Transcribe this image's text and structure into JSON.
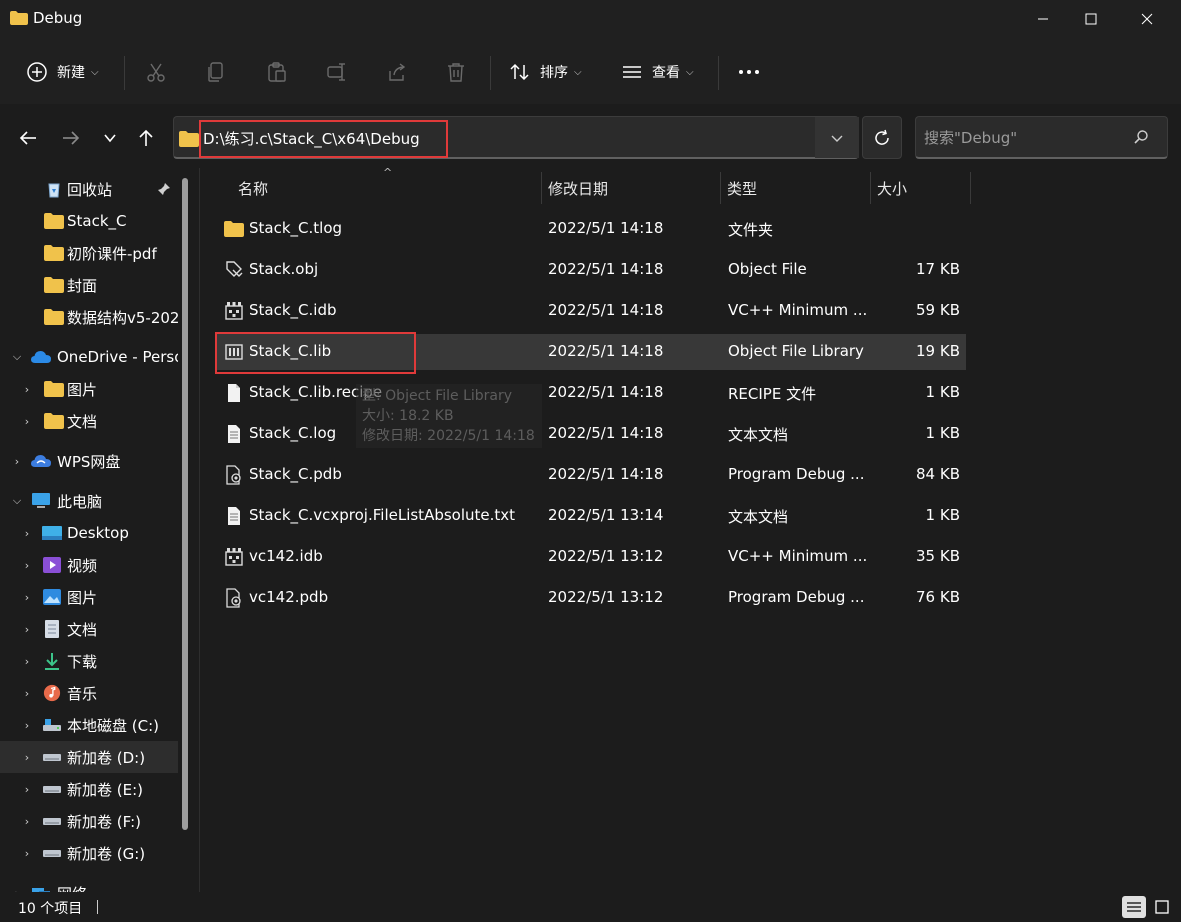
{
  "window": {
    "title": "Debug",
    "minimize_icon": "minimize-icon",
    "maximize_icon": "maximize-icon",
    "close_icon": "close-icon"
  },
  "toolbar": {
    "new_label": "新建",
    "sort_label": "排序",
    "view_label": "查看",
    "icons": [
      "cut-icon",
      "copy-icon",
      "paste-icon",
      "rename-icon",
      "share-icon",
      "delete-icon",
      "more-icon"
    ]
  },
  "address": {
    "path": "D:\\练习.c\\Stack_C\\x64\\Debug"
  },
  "search": {
    "placeholder": "搜索\"Debug\""
  },
  "sidebar": {
    "items": [
      {
        "label": "回收站",
        "icon": "recycle-bin-icon",
        "pinned": true
      },
      {
        "label": "Stack_C",
        "icon": "folder-icon"
      },
      {
        "label": "初阶课件-pdf",
        "icon": "folder-icon"
      },
      {
        "label": "封面",
        "icon": "folder-icon"
      },
      {
        "label": "数据结构v5-202",
        "icon": "folder-icon"
      },
      {
        "label": "OneDrive - Perso",
        "icon": "onedrive-icon"
      },
      {
        "label": "图片",
        "icon": "folder-icon"
      },
      {
        "label": "文档",
        "icon": "folder-icon"
      },
      {
        "label": "WPS网盘",
        "icon": "wps-cloud-icon"
      },
      {
        "label": "此电脑",
        "icon": "pc-icon"
      },
      {
        "label": "Desktop",
        "icon": "desktop-icon"
      },
      {
        "label": "视频",
        "icon": "videos-icon"
      },
      {
        "label": "图片",
        "icon": "pictures-icon"
      },
      {
        "label": "文档",
        "icon": "documents-icon"
      },
      {
        "label": "下载",
        "icon": "downloads-icon"
      },
      {
        "label": "音乐",
        "icon": "music-icon"
      },
      {
        "label": "本地磁盘 (C:)",
        "icon": "drive-c-icon"
      },
      {
        "label": "新加卷 (D:)",
        "icon": "drive-icon"
      },
      {
        "label": "新加卷 (E:)",
        "icon": "drive-icon"
      },
      {
        "label": "新加卷 (F:)",
        "icon": "drive-icon"
      },
      {
        "label": "新加卷 (G:)",
        "icon": "drive-icon"
      },
      {
        "label": "网络",
        "icon": "network-icon"
      }
    ]
  },
  "columns": {
    "name": "名称",
    "modified": "修改日期",
    "type": "类型",
    "size": "大小"
  },
  "files": [
    {
      "name": "Stack_C.tlog",
      "modified": "2022/5/1 14:18",
      "type": "文件夹",
      "size": "",
      "icon": "folder-icon"
    },
    {
      "name": "Stack.obj",
      "modified": "2022/5/1 14:18",
      "type": "Object File",
      "size": "17 KB",
      "icon": "obj-file-icon"
    },
    {
      "name": "Stack_C.idb",
      "modified": "2022/5/1 14:18",
      "type": "VC++ Minimum ...",
      "size": "59 KB",
      "icon": "idb-file-icon"
    },
    {
      "name": "Stack_C.lib",
      "modified": "2022/5/1 14:18",
      "type": "Object File Library",
      "size": "19 KB",
      "icon": "lib-file-icon"
    },
    {
      "name": "Stack_C.lib.recipe",
      "modified": "2022/5/1 14:18",
      "type": "RECIPE 文件",
      "size": "1 KB",
      "icon": "generic-file-icon"
    },
    {
      "name": "Stack_C.log",
      "modified": "2022/5/1 14:18",
      "type": "文本文档",
      "size": "1 KB",
      "icon": "text-file-icon"
    },
    {
      "name": "Stack_C.pdb",
      "modified": "2022/5/1 14:18",
      "type": "Program Debug ...",
      "size": "84 KB",
      "icon": "pdb-file-icon"
    },
    {
      "name": "Stack_C.vcxproj.FileListAbsolute.txt",
      "modified": "2022/5/1 13:14",
      "type": "文本文档",
      "size": "1 KB",
      "icon": "text-file-icon"
    },
    {
      "name": "vc142.idb",
      "modified": "2022/5/1 13:12",
      "type": "VC++ Minimum ...",
      "size": "35 KB",
      "icon": "idb-file-icon"
    },
    {
      "name": "vc142.pdb",
      "modified": "2022/5/1 13:12",
      "type": "Program Debug ...",
      "size": "76 KB",
      "icon": "pdb-file-icon"
    }
  ],
  "tooltip": {
    "line1": "型: Object File Library",
    "line2": "大小: 18.2 KB",
    "line3": "修改日期: 2022/5/1 14:18"
  },
  "status": {
    "count": "10 个项目"
  },
  "colors": {
    "highlight": "#e03a3a",
    "background": "#1c1c1c",
    "folder": "#f0c24b"
  }
}
